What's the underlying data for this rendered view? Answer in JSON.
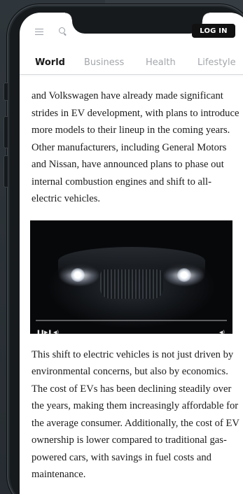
{
  "header": {
    "login_label": "LOG IN",
    "menu_icon": "menu-icon",
    "search_icon": "search-icon"
  },
  "tabs": [
    {
      "label": "World",
      "active": true
    },
    {
      "label": "Business",
      "active": false
    },
    {
      "label": "Health",
      "active": false
    },
    {
      "label": "Lifestyle",
      "active": false
    }
  ],
  "article": {
    "paragraph_1": "and Volkswagen have already made significant strides in EV development, with plans to introduce more models to their lineup in the coming years. Other manufacturers, including General Motors and Nissan, have announced plans to phase out internal combustion engines and shift to all-electric vehicles.",
    "paragraph_2": "This shift to electric vehicles is not just driven by environmental concerns, but also by economics. The cost of EVs has been declining steadily over the years, making them increasingly affordable for the average consumer. Additionally, the cost of EV ownership is lower compared to traditional gas-powered cars, with savings in fuel costs and maintenance."
  },
  "video": {
    "pause_icon": "pause-icon",
    "next_icon": "skip-next-icon",
    "volume_icon": "volume-icon",
    "fullscreen_volume_icon": "volume-icon",
    "progress": 0
  },
  "colors": {
    "accent": "#111111",
    "tab_inactive": "#a3a7ab",
    "text": "#1b1b1b"
  }
}
